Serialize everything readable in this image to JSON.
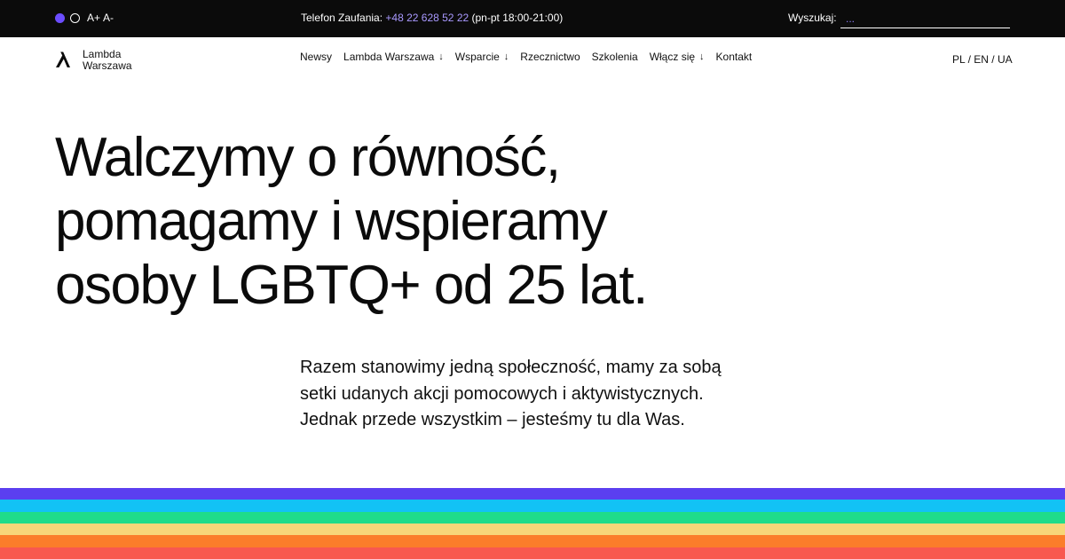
{
  "topbar": {
    "font_increase": "A+",
    "font_decrease": "A-",
    "hotline_label": "Telefon Zaufania:",
    "hotline_number": "+48 22 628 52 22",
    "hotline_hours": "(pn-pt 18:00-21:00)",
    "search_label": "Wyszukaj:",
    "search_placeholder": "...",
    "accent": "#6b4dff",
    "link_color": "#a999ff"
  },
  "header": {
    "logo_line1": "Lambda",
    "logo_line2": "Warszawa",
    "nav": [
      {
        "label": "Newsy",
        "dropdown": false
      },
      {
        "label": "Lambda Warszawa",
        "dropdown": true
      },
      {
        "label": "Wsparcie",
        "dropdown": true
      },
      {
        "label": "Rzecznictwo",
        "dropdown": false
      },
      {
        "label": "Szkolenia",
        "dropdown": false
      },
      {
        "label": "Włącz się",
        "dropdown": true
      },
      {
        "label": "Kontakt",
        "dropdown": false
      }
    ],
    "arrow_glyph": "↓",
    "languages": [
      "PL",
      "EN",
      "UA"
    ],
    "language_separator": "/"
  },
  "hero": {
    "title_lines": [
      "Walczymy o równość,",
      "pomagamy i wspieramy",
      "osoby LGBTQ+ od 25 lat."
    ],
    "lead_lines": [
      "Razem stanowimy jedną społeczność, mamy za sobą",
      "setki udanych akcji pomocowych i aktywistycznych.",
      "Jednak przede wszystkim – jesteśmy tu dla Was."
    ]
  },
  "rainbow": [
    "#5b3ff0",
    "#12c2f5",
    "#1fdc8a",
    "#f7d679",
    "#fb7d2a",
    "#f8584f"
  ]
}
